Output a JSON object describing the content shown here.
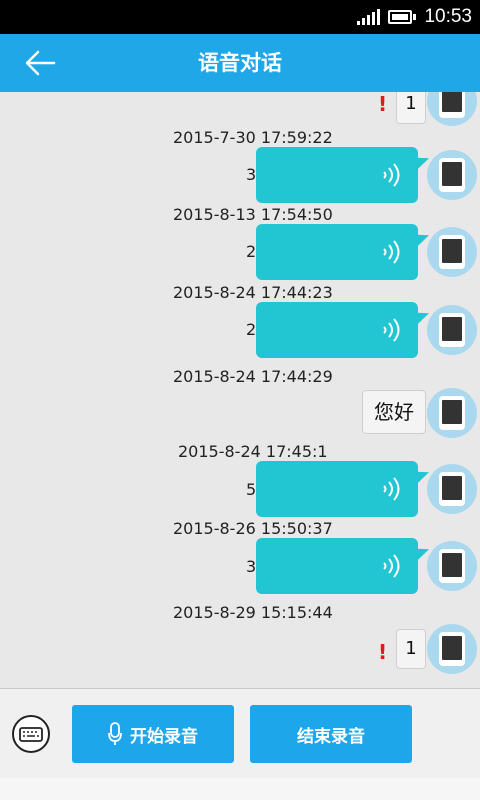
{
  "status": {
    "time": "10:53"
  },
  "header": {
    "title": "语音对话"
  },
  "messages": [
    {
      "type": "text-error",
      "content": "1"
    },
    {
      "type": "voice",
      "timestamp": "2015-7-30 17:59:22",
      "duration": "3"
    },
    {
      "type": "voice",
      "timestamp": "2015-8-13 17:54:50",
      "duration": "2"
    },
    {
      "type": "voice",
      "timestamp": "2015-8-24 17:44:23",
      "duration": "2"
    },
    {
      "type": "text",
      "timestamp": "2015-8-24 17:44:29",
      "content": "您好"
    },
    {
      "type": "voice",
      "timestamp": "2015-8-24 17:45:1",
      "duration": "5"
    },
    {
      "type": "voice",
      "timestamp": "2015-8-26 15:50:37",
      "duration": "3"
    },
    {
      "type": "text-error",
      "timestamp": "2015-8-29 15:15:44",
      "content": "1"
    }
  ],
  "error_mark": "!",
  "bottom": {
    "start_label": "开始录音",
    "end_label": "结束录音"
  },
  "colors": {
    "header": "#1fa7e8",
    "voice_bubble": "#22c5d2",
    "button": "#1da6ea",
    "error": "#e01a1a"
  },
  "icons": [
    "back-arrow-icon",
    "signal-icon",
    "battery-icon",
    "voice-wave-icon",
    "phone-avatar-icon",
    "keyboard-icon",
    "microphone-icon"
  ]
}
